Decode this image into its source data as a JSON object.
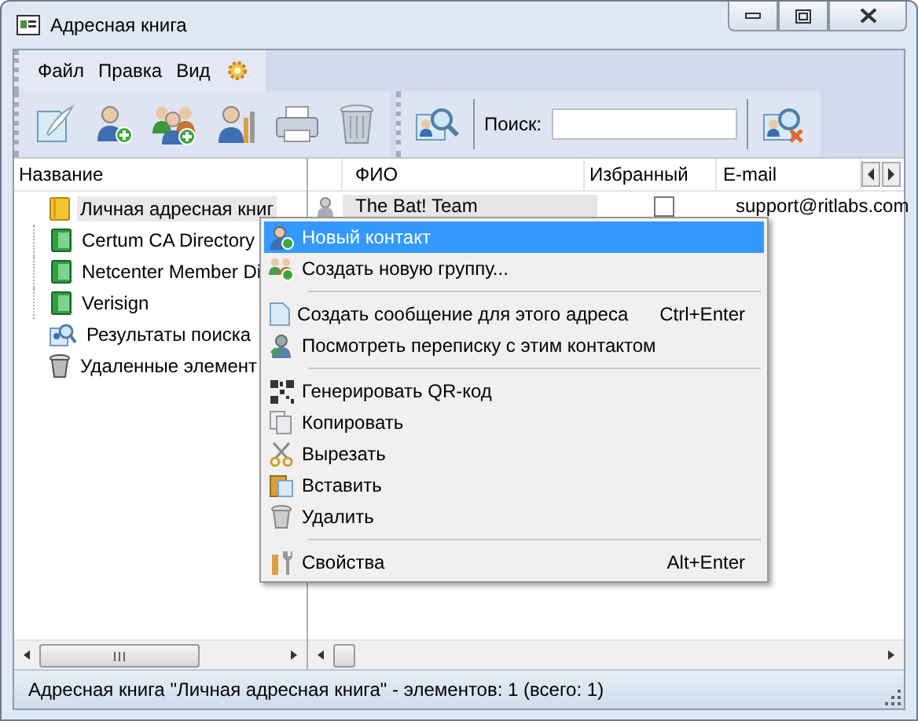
{
  "window": {
    "title": "Адресная книга"
  },
  "menu": [
    "Файл",
    "Правка",
    "Вид"
  ],
  "toolbar": {
    "search_label": "Поиск:"
  },
  "tree": {
    "header": "Название",
    "items": [
      {
        "label": "Личная адресная книг",
        "kind": "book",
        "selected": true
      },
      {
        "label": "Certum CA Directory",
        "kind": "directory",
        "selected": false
      },
      {
        "label": "Netcenter Member Di",
        "kind": "directory",
        "selected": false
      },
      {
        "label": "Verisign",
        "kind": "directory",
        "selected": false
      },
      {
        "label": "Результаты поиска",
        "kind": "search",
        "selected": false
      },
      {
        "label": "Удаленные элемент",
        "kind": "trash",
        "selected": false
      }
    ]
  },
  "table": {
    "columns": [
      "ФИО",
      "Избранный",
      "E-mail"
    ],
    "rows": [
      {
        "name": "The Bat! Team",
        "favorite": false,
        "email": "support@ritlabs.com",
        "selected": true
      }
    ]
  },
  "context_menu": [
    {
      "kind": "item",
      "label": "Новый контакт",
      "selected": true
    },
    {
      "kind": "item",
      "label": "Создать новую группу...",
      "selected": false
    },
    {
      "kind": "separator"
    },
    {
      "kind": "item",
      "label": "Создать сообщение для этого адреса",
      "shortcut": "Ctrl+Enter",
      "selected": false
    },
    {
      "kind": "item",
      "label": "Посмотреть переписку с этим контактом",
      "selected": false
    },
    {
      "kind": "separator"
    },
    {
      "kind": "item",
      "label": "Генерировать QR-код",
      "selected": false
    },
    {
      "kind": "item",
      "label": "Копировать",
      "selected": false
    },
    {
      "kind": "item",
      "label": "Вырезать",
      "selected": false
    },
    {
      "kind": "item",
      "label": "Вставить",
      "selected": false
    },
    {
      "kind": "item",
      "label": "Удалить",
      "selected": false
    },
    {
      "kind": "separator"
    },
    {
      "kind": "item",
      "label": "Свойства",
      "shortcut": "Alt+Enter",
      "selected": false
    }
  ],
  "status_bar": "Адресная книга \"Личная адресная книга\" - элементов: 1 (всего: 1)"
}
